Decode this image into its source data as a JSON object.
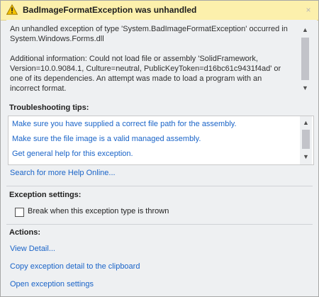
{
  "dialog": {
    "title": "BadImageFormatException was unhandled",
    "close_glyph": "×",
    "message_line1": "An unhandled exception of type 'System.BadImageFormatException' occurred in System.Windows.Forms.dll",
    "message_line2": "Additional information: Could not load file or assembly 'SolidFramework, Version=10.0.9084.1, Culture=neutral, PublicKeyToken=d16bc61c9431f4ad' or one of its dependencies. An attempt was made to load a program with an incorrect format."
  },
  "troubleshooting": {
    "heading": "Troubleshooting tips:",
    "tips": [
      "Make sure you have supplied a correct file path for the assembly.",
      "Make sure the file image is a valid managed assembly.",
      "Get general help for this exception."
    ],
    "search_link": "Search for more Help Online..."
  },
  "exception_settings": {
    "heading": "Exception settings:",
    "checkbox_label": "Break when this exception type is thrown",
    "checked": false
  },
  "actions": {
    "heading": "Actions:",
    "items": [
      "View Detail...",
      "Copy exception detail to the clipboard",
      "Open exception settings"
    ]
  },
  "icons": {
    "warning": "warning-icon",
    "scroll_up": "chevron-up-icon",
    "scroll_down": "chevron-down-icon"
  },
  "colors": {
    "title_bar": "#fcf0ac",
    "link": "#1a64c8",
    "warning_fill": "#f5c400"
  }
}
